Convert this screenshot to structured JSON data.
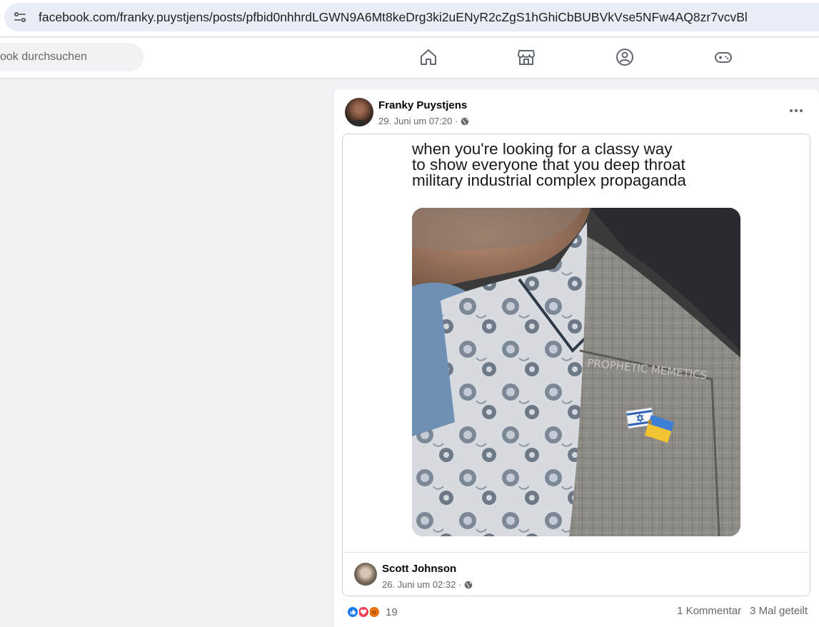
{
  "browser": {
    "url": "facebook.com/franky.puystjens/posts/pfbid0nhhrdLGWN9A6Mt8keDrg3ki2uENyR2cZgS1hGhiCbBUBVkVse5NFw4AQ8zr7vcvBl"
  },
  "nav": {
    "search_placeholder": "ook durchsuchen",
    "icons": [
      "home-icon",
      "marketplace-icon",
      "groups-icon",
      "gaming-icon"
    ]
  },
  "post": {
    "author": "Franky Puystjens",
    "timestamp": "29. Juni um 07:20 ·",
    "shared": {
      "caption_lines": [
        "when you're looking for a classy way",
        "to show everyone that you deep throat",
        "military industrial complex propaganda"
      ],
      "photo_text": "PROPHETIC MEMETICS",
      "author": "Scott Johnson",
      "timestamp": "26. Juni um 02:32 ·"
    },
    "reactions": {
      "types": [
        "like",
        "love",
        "angry"
      ],
      "count": "19"
    },
    "comments": "1 Kommentar",
    "shares": "3 Mal geteilt"
  },
  "colors": {
    "accent": "#1877f2",
    "background": "#f0f2f5",
    "secondary_text": "#65676b"
  }
}
